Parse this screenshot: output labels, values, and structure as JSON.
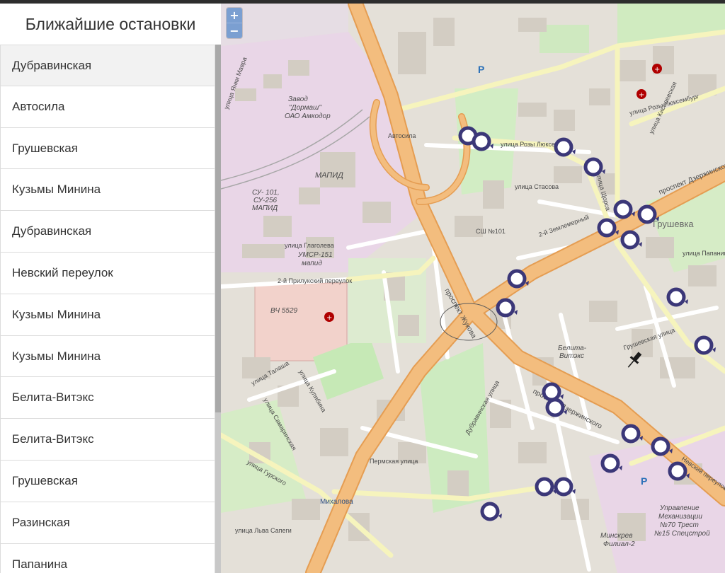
{
  "sidebar": {
    "title": "Ближайшие остановки",
    "stops": [
      "Дубравинская",
      "Автосила",
      "Грушевская",
      "Кузьмы Минина",
      "Дубравинская",
      "Невский переулок",
      "Кузьмы Минина",
      "Кузьмы Минина",
      "Белита-Витэкс",
      "Белита-Витэкс",
      "Грушевская",
      "Разинская",
      "Папанина"
    ]
  },
  "map": {
    "zoom_in": "+",
    "zoom_out": "−",
    "labels": {
      "zavod": "Завод",
      "dormash": "\"Дормаш\"",
      "amkodor": "ОАО Амкодор",
      "mapid": "МАПИД",
      "su101": "СУ- 101,",
      "su256": "СУ-256",
      "mapid2": "МАПИД",
      "umsr": "УМСР-151",
      "mapid3": "мапид",
      "vch": "ВЧ 5529",
      "glagoleva": "улица Глаголева",
      "prilukskiy": "2-й Прилукский переулок",
      "rozy": "улица Розы Люксембург",
      "rozy2": "улица Розы Люксембург",
      "stasova": "улица Стасова",
      "zemlemer": "2-й Земле­мерный",
      "sh101": "СШ №101",
      "shorsa": "улица Щорса",
      "dzerzh": "проспект Дзержинского",
      "grushevka": "Грушевка",
      "zhukova": "проспект Жукова",
      "gurskogo": "улица Гурского",
      "mikhalova": "Михалова",
      "belita": "Белита-",
      "vitex": "Витэкс",
      "grushevskaya_ul": "Грушевская улица",
      "papanina": "улица Папанина",
      "upravlenie": "Управление",
      "mekhanizatsii": "Механизации",
      "n70": "№70 Трест",
      "n15": "№15 Спецстрой",
      "minskrev": "Минскрев",
      "filial": "Филиал-2",
      "nevskiy": "Невский переулок",
      "dubravinskaya": "Дубравинская улица",
      "permskaya": "Пермская улица",
      "tatsha": "улица Талаша",
      "kulibina": "улица Кулибина",
      "samarskaya": "улица Самаринская",
      "slavy": "улица Льва Сапеги",
      "mavra": "улица Янки Мавра",
      "kiselevskaya": "улица Киселевская",
      "avtosila": "Автосила",
      "dzerzh2": "проспект Дзержинского",
      "p": "P"
    }
  },
  "colors": {
    "accent": "#7b9fd1",
    "stop_marker": "#3b3778",
    "road_major": "#f3bd7e",
    "road_secondary": "#f6f4bd",
    "park": "#c6e9b6",
    "industrial": "#e9d6e7"
  }
}
